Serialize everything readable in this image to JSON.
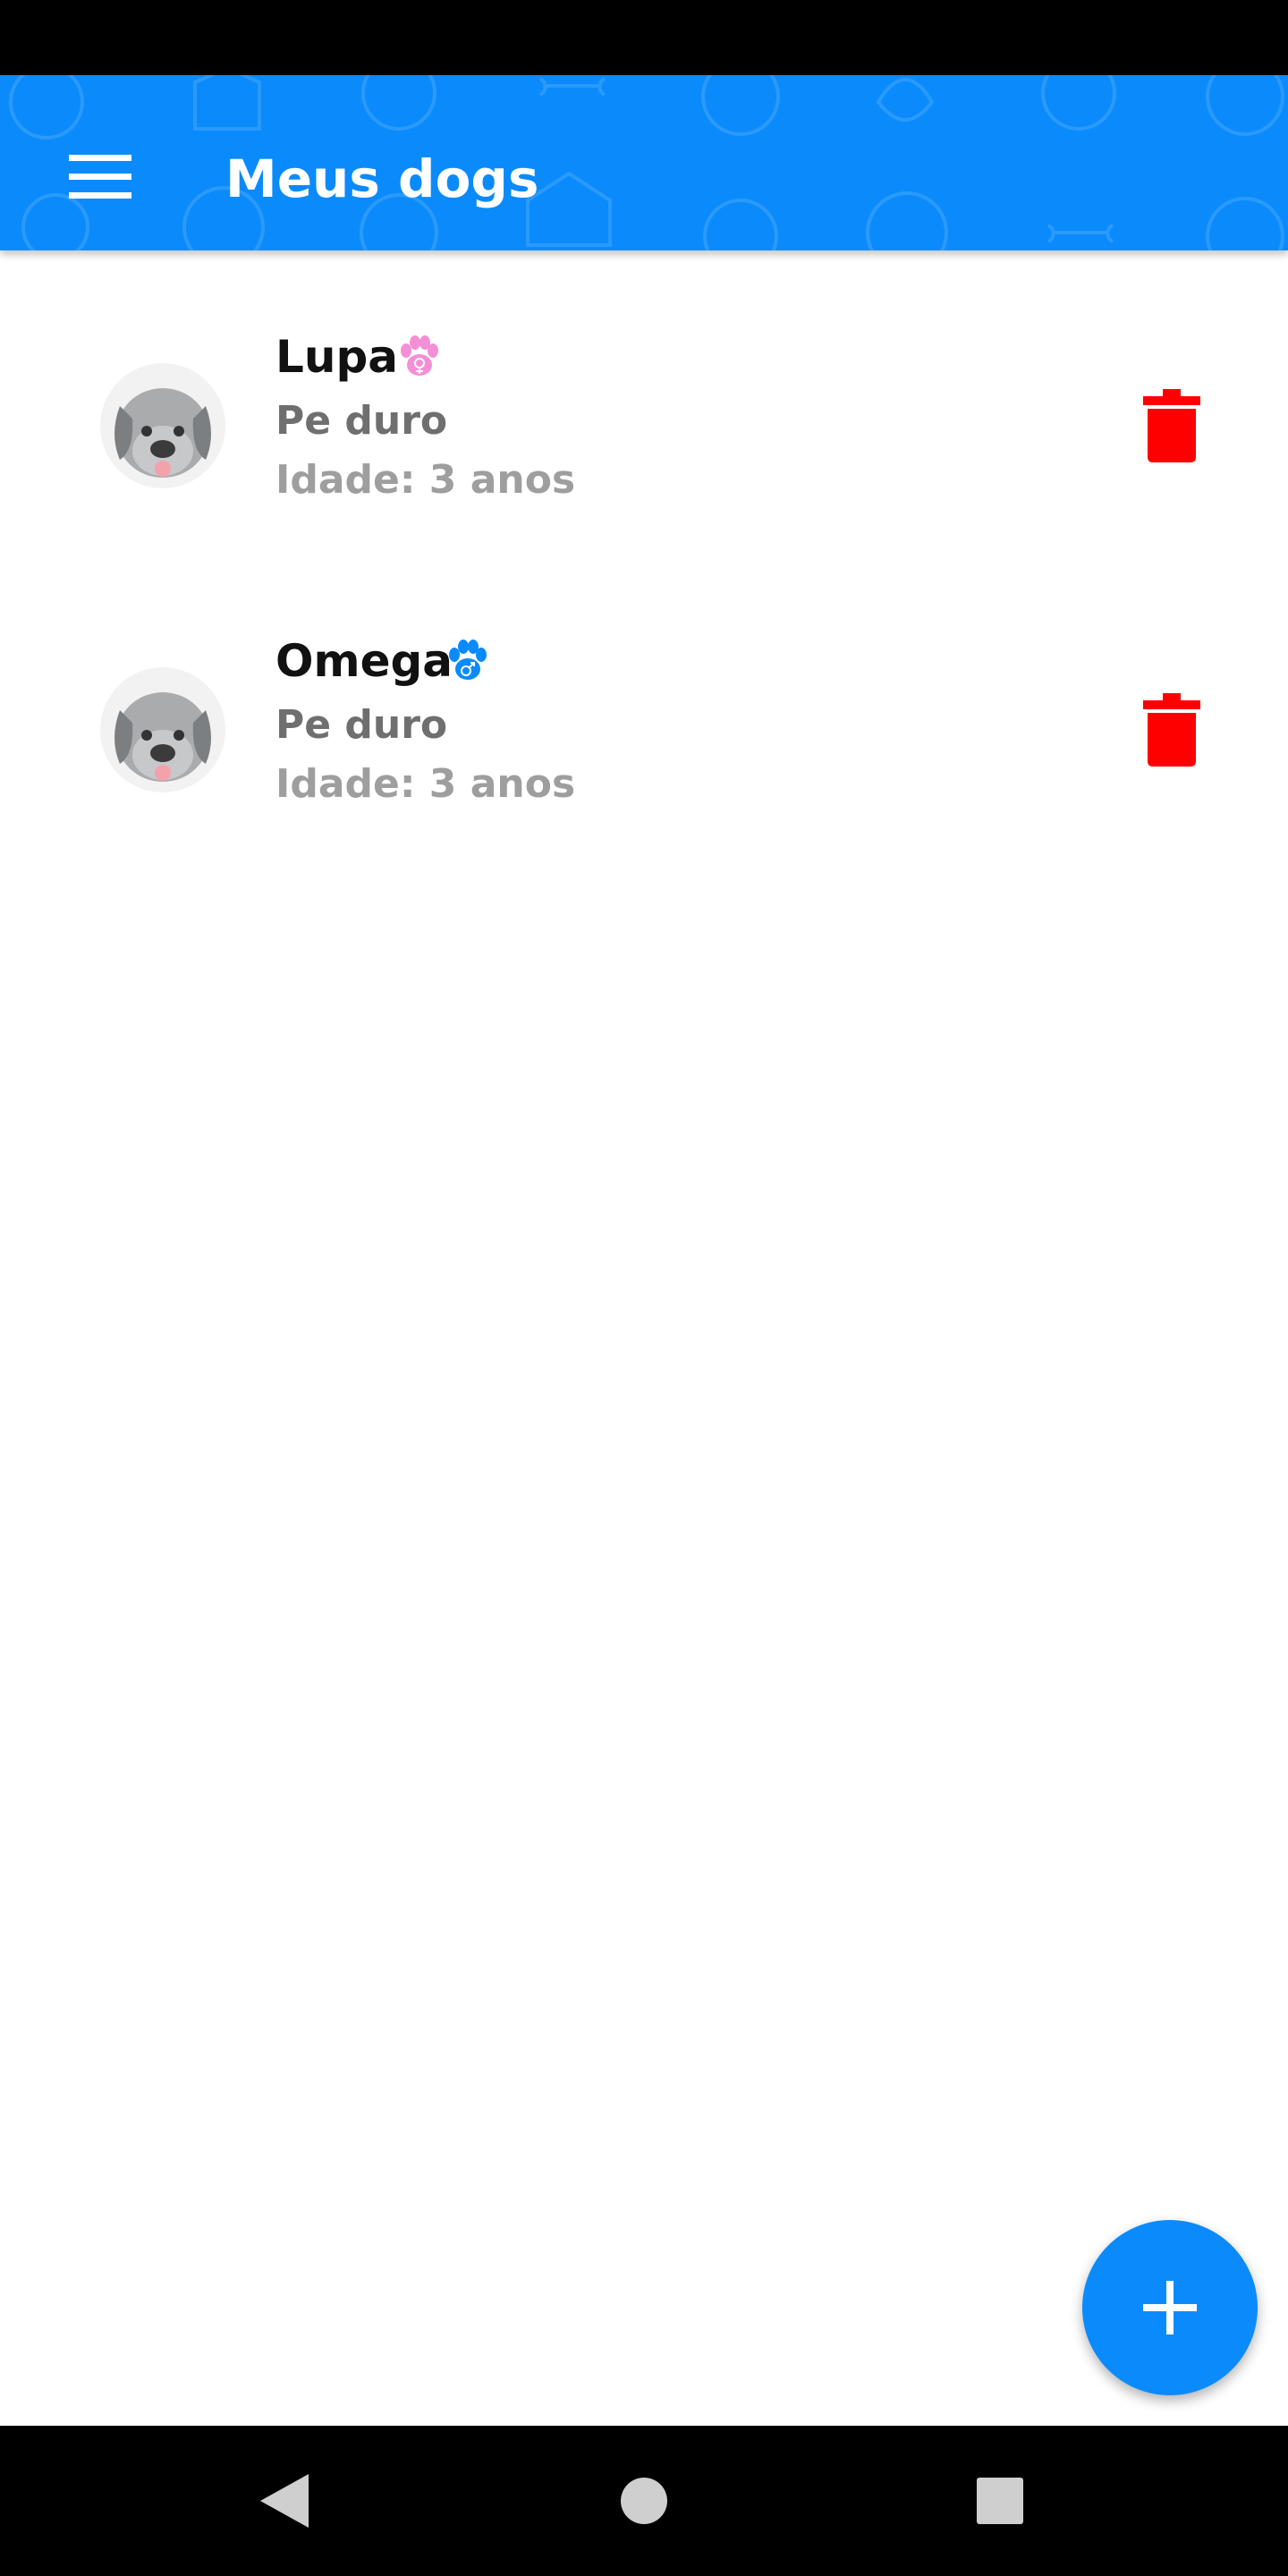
{
  "header": {
    "title": "Meus dogs",
    "menu_icon": "hamburger-menu-icon",
    "background_color": "#0b8bfb"
  },
  "dogs": [
    {
      "name": "Lupa",
      "sex_icon": "paw-female-icon",
      "sex_color": "#f48fd6",
      "breed": "Pe duro",
      "age": "Idade: 3 anos"
    },
    {
      "name": "Omega",
      "sex_icon": "paw-male-icon",
      "sex_color": "#0b8bfb",
      "breed": "Pe duro",
      "age": "Idade: 3 anos"
    }
  ],
  "actions": {
    "delete_icon": "trash-icon",
    "delete_color": "#ff0000",
    "add_icon": "plus-icon"
  },
  "system_nav": {
    "back_icon": "back-triangle-icon",
    "home_icon": "home-circle-icon",
    "recents_icon": "recents-square-icon"
  }
}
